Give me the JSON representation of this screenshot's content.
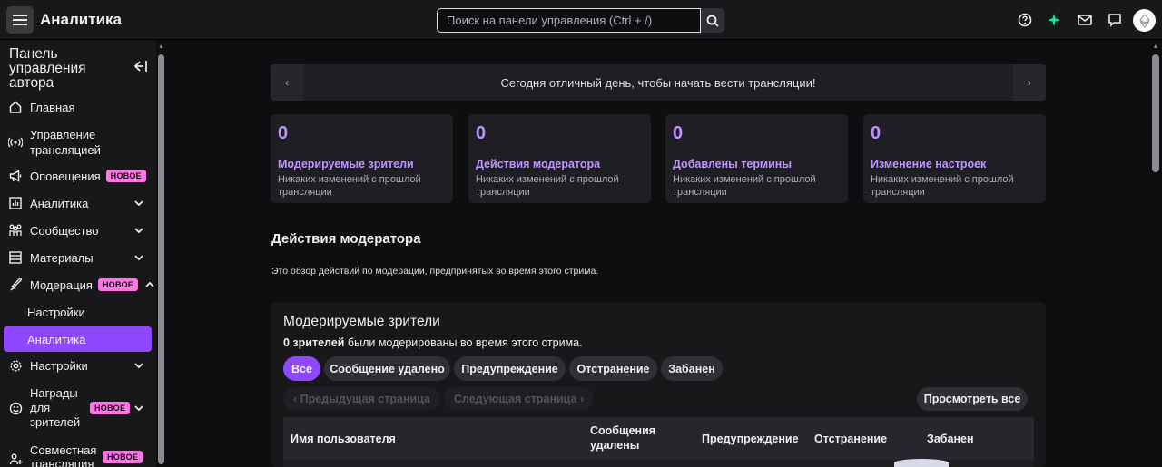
{
  "topbar": {
    "title": "Аналитика",
    "search_placeholder": "Поиск на панели управления (Ctrl + /)"
  },
  "sidebar": {
    "header": "Панель управления автора",
    "items": [
      {
        "label": "Главная",
        "icon": "home-icon"
      },
      {
        "label": "Управление трансляцией",
        "icon": "broadcast-icon"
      },
      {
        "label": "Оповещения",
        "icon": "megaphone-icon",
        "badge": "НОВОЕ"
      },
      {
        "label": "Аналитика",
        "icon": "analytics-icon",
        "expand": "down"
      },
      {
        "label": "Сообщество",
        "icon": "community-icon",
        "expand": "down"
      },
      {
        "label": "Материалы",
        "icon": "content-icon",
        "expand": "down"
      },
      {
        "label": "Модерация",
        "icon": "sword-icon",
        "badge": "НОВОЕ",
        "expand": "up"
      },
      {
        "label": "Настройки",
        "icon": "gear-icon",
        "expand": "down"
      },
      {
        "label": "Награды для зрителей",
        "icon": "rewards-icon",
        "badge": "НОВОЕ",
        "expand": "down"
      },
      {
        "label": "Совместная трансляция",
        "icon": "collab-icon",
        "badge": "НОВОЕ"
      }
    ],
    "moderation_sub": [
      {
        "label": "Настройки"
      },
      {
        "label": "Аналитика",
        "active": true
      }
    ]
  },
  "banner": {
    "message": "Сегодня отличный день, чтобы начать вести трансляции!"
  },
  "stats": [
    {
      "value": "0",
      "label": "Модерируемые зрители",
      "sub": "Никаких изменений с прошлой трансляции"
    },
    {
      "value": "0",
      "label": "Действия модератора",
      "sub": "Никаких изменений с прошлой трансляции"
    },
    {
      "value": "0",
      "label": "Добавлены термины",
      "sub": "Никаких изменений с прошлой трансляции"
    },
    {
      "value": "0",
      "label": "Изменение настроек",
      "sub": "Никаких изменений с прошлой трансляции"
    }
  ],
  "section": {
    "title": "Действия модератора",
    "description": "Это обзор действий по модерации, предпринятых во время этого стрима."
  },
  "panel": {
    "title": "Модерируемые зрители",
    "desc_count": "0 зрителей",
    "desc_rest": " были модерированы во время этого стрима.",
    "filters": [
      "Все",
      "Сообщение удалено",
      "Предупреждение",
      "Отстранение",
      "Забанен"
    ],
    "prev_page": "Предыдущая страница",
    "next_page": "Следующая страница",
    "view_all": "Просмотреть все",
    "columns": [
      "Имя пользователя",
      "Сообщения удалены",
      "Предупреждение",
      "Отстранение",
      "Забанен"
    ]
  },
  "colors": {
    "accent": "#9147ff",
    "accent_text": "#bf94ff",
    "badge": "#ff75e6",
    "background": "#0e0e10",
    "surface": "#18181b"
  }
}
